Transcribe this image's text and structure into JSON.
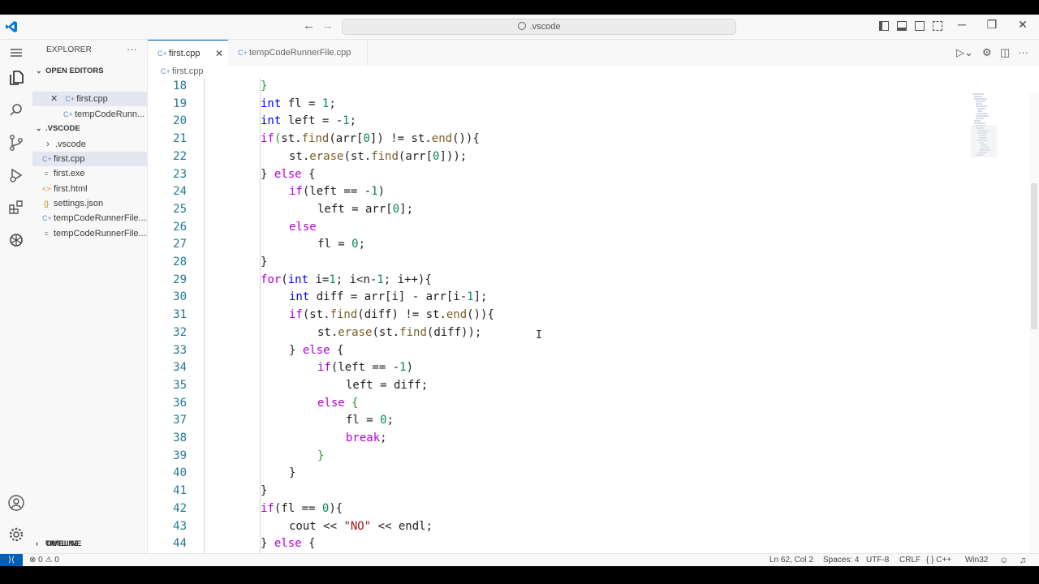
{
  "titlebar": {
    "search_text": ".vscode",
    "back_icon": "arrow-left-icon",
    "forward_icon": "arrow-right-icon"
  },
  "window_controls": {
    "minimize": "─",
    "restore": "❐",
    "close": "✕"
  },
  "sidebar": {
    "title": "EXPLORER",
    "more": "···",
    "open_editors_label": "OPEN EDITORS",
    "open_editors": [
      {
        "name": "first.cpp",
        "close": "✕",
        "icon": "cpp-file-icon"
      },
      {
        "name": "tempCodeRunn...",
        "icon": "cpp-file-icon"
      }
    ],
    "folder_label": ".VSCODE",
    "files": [
      {
        "name": ".vscode",
        "glyph": "›",
        "icon": "folder-chevron-icon"
      },
      {
        "name": "first.cpp",
        "glyph": "C+",
        "icon": "cpp-file-icon"
      },
      {
        "name": "first.exe",
        "glyph": "≡",
        "icon": "exe-file-icon"
      },
      {
        "name": "first.html",
        "glyph": "<>",
        "icon": "html-file-icon"
      },
      {
        "name": "settings.json",
        "glyph": "{}",
        "icon": "json-file-icon"
      },
      {
        "name": "tempCodeRunnerFile....",
        "glyph": "C+",
        "icon": "cpp-file-icon"
      },
      {
        "name": "tempCodeRunnerFile....",
        "glyph": "≡",
        "icon": "exe-file-icon"
      }
    ],
    "outline_label": "OUTLINE",
    "timeline_label": "TIMELINE"
  },
  "tabs": [
    {
      "label": "first.cpp",
      "close": "✕"
    },
    {
      "label": "tempCodeRunnerFile.cpp"
    }
  ],
  "breadcrumb": "first.cpp",
  "code_lines": [
    {
      "n": "18"
    },
    {
      "n": "19"
    },
    {
      "n": "20"
    },
    {
      "n": "21"
    },
    {
      "n": "22"
    },
    {
      "n": "23"
    },
    {
      "n": "24"
    },
    {
      "n": "25"
    },
    {
      "n": "26"
    },
    {
      "n": "27"
    },
    {
      "n": "28"
    },
    {
      "n": "29"
    },
    {
      "n": "30"
    },
    {
      "n": "31"
    },
    {
      "n": "32"
    },
    {
      "n": "33"
    },
    {
      "n": "34"
    },
    {
      "n": "35"
    },
    {
      "n": "36"
    },
    {
      "n": "37"
    },
    {
      "n": "38"
    },
    {
      "n": "39"
    },
    {
      "n": "40"
    },
    {
      "n": "41"
    },
    {
      "n": "42"
    },
    {
      "n": "43"
    },
    {
      "n": "44"
    }
  ],
  "code": {
    "l18": "}",
    "l19_kw": "int",
    "l19_rest": " fl = ",
    "l19_num": "1",
    "l19_end": ";",
    "l20_kw": "int",
    "l20_rest": " left = -",
    "l20_num": "1",
    "l20_end": ";",
    "l21_if": "if",
    "l21_a": "st.",
    "l21_fn": "find",
    "l21_b": "(arr[",
    "l21_num": "0",
    "l21_c": "]) != st.",
    "l21_fn2": "end",
    "l21_d": "()){",
    "l22_a": "st.",
    "l22_fn": "erase",
    "l22_b": "(st.",
    "l22_fn2": "find",
    "l22_c": "(arr[",
    "l22_num": "0",
    "l22_d": "]));",
    "l23_a": "} ",
    "l23_else": "else",
    "l23_b": " {",
    "l24_if": "if",
    "l24_a": "(left == -",
    "l24_num": "1",
    "l24_b": ")",
    "l25_a": "left = arr[",
    "l25_num": "0",
    "l25_b": "];",
    "l26_else": "else",
    "l27_a": "fl = ",
    "l27_num": "0",
    "l27_b": ";",
    "l28": "}",
    "l29_for": "for",
    "l29_a": "(",
    "l29_kw": "int",
    "l29_b": " i=",
    "l29_num": "1",
    "l29_c": "; i<n-",
    "l29_num2": "1",
    "l29_d": "; i++){",
    "l30_kw": "int",
    "l30_a": " diff = arr[i] - arr[i-",
    "l30_num": "1",
    "l30_b": "];",
    "l31_if": "if",
    "l31_a": "(st.",
    "l31_fn": "find",
    "l31_b": "(diff) != st.",
    "l31_fn2": "end",
    "l31_c": "()){",
    "l32_a": "st.",
    "l32_fn": "erase",
    "l32_b": "(st.",
    "l32_fn2": "find",
    "l32_c": "(diff));",
    "l33_a": "} ",
    "l33_else": "else",
    "l33_b": " {",
    "l34_if": "if",
    "l34_a": "(left == -",
    "l34_num": "1",
    "l34_b": ")",
    "l35": "left = diff;",
    "l36_else": "else",
    "l36_b": " {",
    "l37_a": "fl = ",
    "l37_num": "0",
    "l37_b": ";",
    "l38_break": "break",
    "l38_b": ";",
    "l39": "}",
    "l40": "}",
    "l41": "}",
    "l42_if": "if",
    "l42_a": "(fl == ",
    "l42_num": "0",
    "l42_b": "){",
    "l43_a": "cout << ",
    "l43_str": "\"NO\"",
    "l43_b": " << endl;",
    "l44_a": "} ",
    "l44_else": "else",
    "l44_b": " {"
  },
  "status": {
    "remote_icon": "remote-icon",
    "problems": "⊗ 0 ⚠ 0",
    "position": "Ln 62, Col 2",
    "spaces": "Spaces: 4",
    "encoding": "UTF-8",
    "eol": "CRLF",
    "language": "{ } C++",
    "platform": "Win32"
  },
  "colors": {
    "accent": "#005fb8",
    "keyword": "#0000ff",
    "control": "#af00db",
    "function": "#795e26",
    "number": "#098658",
    "string": "#a31515",
    "line_number": "#237893"
  }
}
